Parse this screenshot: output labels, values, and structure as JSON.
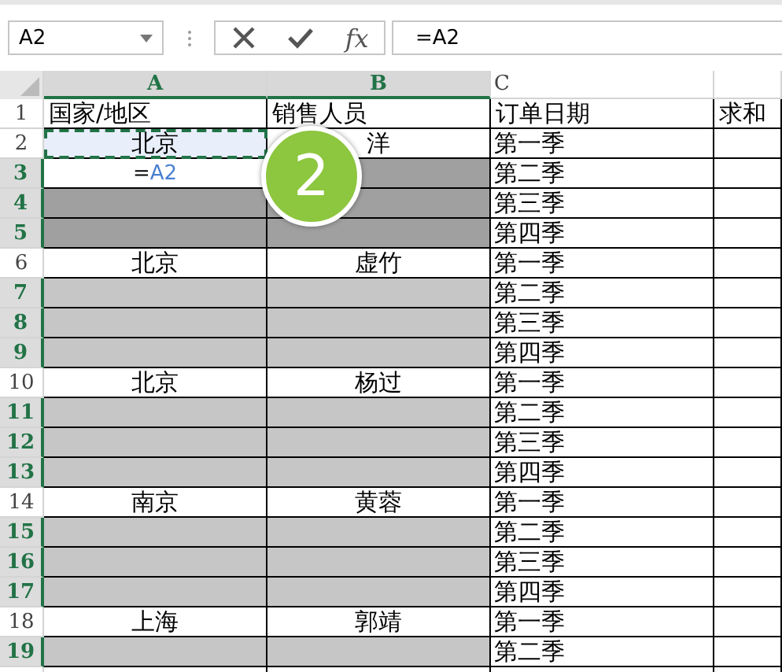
{
  "name_box": {
    "value": "A2"
  },
  "formula_bar": {
    "fx_label": "fx",
    "value": "=A2"
  },
  "columns": [
    {
      "label": "A",
      "selected": true
    },
    {
      "label": "B",
      "selected": true
    },
    {
      "label": "C",
      "selected": false
    }
  ],
  "rows": [
    {
      "number": "1",
      "selected": false,
      "kind": "header",
      "cells": [
        {
          "text": "国家/地区",
          "kind": "none"
        },
        {
          "text": "销售人员",
          "kind": "none"
        },
        {
          "text": "订单日期",
          "kind": "none"
        },
        {
          "text": "求和",
          "kind": "none"
        }
      ]
    },
    {
      "number": "2",
      "selected": false,
      "kind": "data",
      "cells": [
        {
          "text": "北京",
          "kind": "marquee"
        },
        {
          "text": "洋",
          "kind": "none"
        },
        {
          "text": "第一季",
          "kind": "none"
        },
        {
          "kind": "none"
        }
      ]
    },
    {
      "number": "3",
      "selected": true,
      "kind": "data",
      "cells": [
        {
          "text": "=",
          "ref": "A2",
          "kind": "editing"
        },
        {
          "kind": "dark"
        },
        {
          "text": "第二季",
          "kind": "none"
        },
        {
          "kind": "none"
        }
      ]
    },
    {
      "number": "4",
      "selected": true,
      "kind": "data",
      "cells": [
        {
          "kind": "dark"
        },
        {
          "kind": "dark"
        },
        {
          "text": "第三季",
          "kind": "none"
        },
        {
          "kind": "none"
        }
      ]
    },
    {
      "number": "5",
      "selected": true,
      "kind": "data",
      "cells": [
        {
          "kind": "dark"
        },
        {
          "kind": "dark"
        },
        {
          "text": "第四季",
          "kind": "none"
        },
        {
          "kind": "none"
        }
      ]
    },
    {
      "number": "6",
      "selected": false,
      "kind": "data",
      "cells": [
        {
          "text": "北京",
          "kind": "none"
        },
        {
          "text": "虚竹",
          "kind": "none"
        },
        {
          "text": "第一季",
          "kind": "none"
        },
        {
          "kind": "none"
        }
      ]
    },
    {
      "number": "7",
      "selected": true,
      "kind": "data",
      "cells": [
        {
          "kind": "light"
        },
        {
          "kind": "light"
        },
        {
          "text": "第二季",
          "kind": "none"
        },
        {
          "kind": "none"
        }
      ]
    },
    {
      "number": "8",
      "selected": true,
      "kind": "data",
      "cells": [
        {
          "kind": "light"
        },
        {
          "kind": "light"
        },
        {
          "text": "第三季",
          "kind": "none"
        },
        {
          "kind": "none"
        }
      ]
    },
    {
      "number": "9",
      "selected": true,
      "kind": "data",
      "cells": [
        {
          "kind": "light"
        },
        {
          "kind": "light"
        },
        {
          "text": "第四季",
          "kind": "none"
        },
        {
          "kind": "none"
        }
      ]
    },
    {
      "number": "10",
      "selected": false,
      "kind": "data",
      "cells": [
        {
          "text": "北京",
          "kind": "none"
        },
        {
          "text": "杨过",
          "kind": "none"
        },
        {
          "text": "第一季",
          "kind": "none"
        },
        {
          "kind": "none"
        }
      ]
    },
    {
      "number": "11",
      "selected": true,
      "kind": "data",
      "cells": [
        {
          "kind": "light"
        },
        {
          "kind": "light"
        },
        {
          "text": "第二季",
          "kind": "none"
        },
        {
          "kind": "none"
        }
      ]
    },
    {
      "number": "12",
      "selected": true,
      "kind": "data",
      "cells": [
        {
          "kind": "light"
        },
        {
          "kind": "light"
        },
        {
          "text": "第三季",
          "kind": "none"
        },
        {
          "kind": "none"
        }
      ]
    },
    {
      "number": "13",
      "selected": true,
      "kind": "data",
      "cells": [
        {
          "kind": "light"
        },
        {
          "kind": "light"
        },
        {
          "text": "第四季",
          "kind": "none"
        },
        {
          "kind": "none"
        }
      ]
    },
    {
      "number": "14",
      "selected": false,
      "kind": "data",
      "cells": [
        {
          "text": "南京",
          "kind": "none"
        },
        {
          "text": "黄蓉",
          "kind": "none"
        },
        {
          "text": "第一季",
          "kind": "none"
        },
        {
          "kind": "none"
        }
      ]
    },
    {
      "number": "15",
      "selected": true,
      "kind": "data",
      "cells": [
        {
          "kind": "light"
        },
        {
          "kind": "light"
        },
        {
          "text": "第二季",
          "kind": "none"
        },
        {
          "kind": "none"
        }
      ]
    },
    {
      "number": "16",
      "selected": true,
      "kind": "data",
      "cells": [
        {
          "kind": "light"
        },
        {
          "kind": "light"
        },
        {
          "text": "第三季",
          "kind": "none"
        },
        {
          "kind": "none"
        }
      ]
    },
    {
      "number": "17",
      "selected": true,
      "kind": "data",
      "cells": [
        {
          "kind": "light"
        },
        {
          "kind": "light"
        },
        {
          "text": "第四季",
          "kind": "none"
        },
        {
          "kind": "none"
        }
      ]
    },
    {
      "number": "18",
      "selected": false,
      "kind": "data",
      "cells": [
        {
          "text": "上海",
          "kind": "none"
        },
        {
          "text": "郭靖",
          "kind": "none"
        },
        {
          "text": "第一季",
          "kind": "none"
        },
        {
          "kind": "none"
        }
      ]
    },
    {
      "number": "19",
      "selected": true,
      "kind": "data",
      "cells": [
        {
          "kind": "light"
        },
        {
          "kind": "light"
        },
        {
          "text": "第二季",
          "kind": "none"
        },
        {
          "kind": "none"
        }
      ]
    }
  ],
  "step_badge": {
    "label": "2"
  }
}
